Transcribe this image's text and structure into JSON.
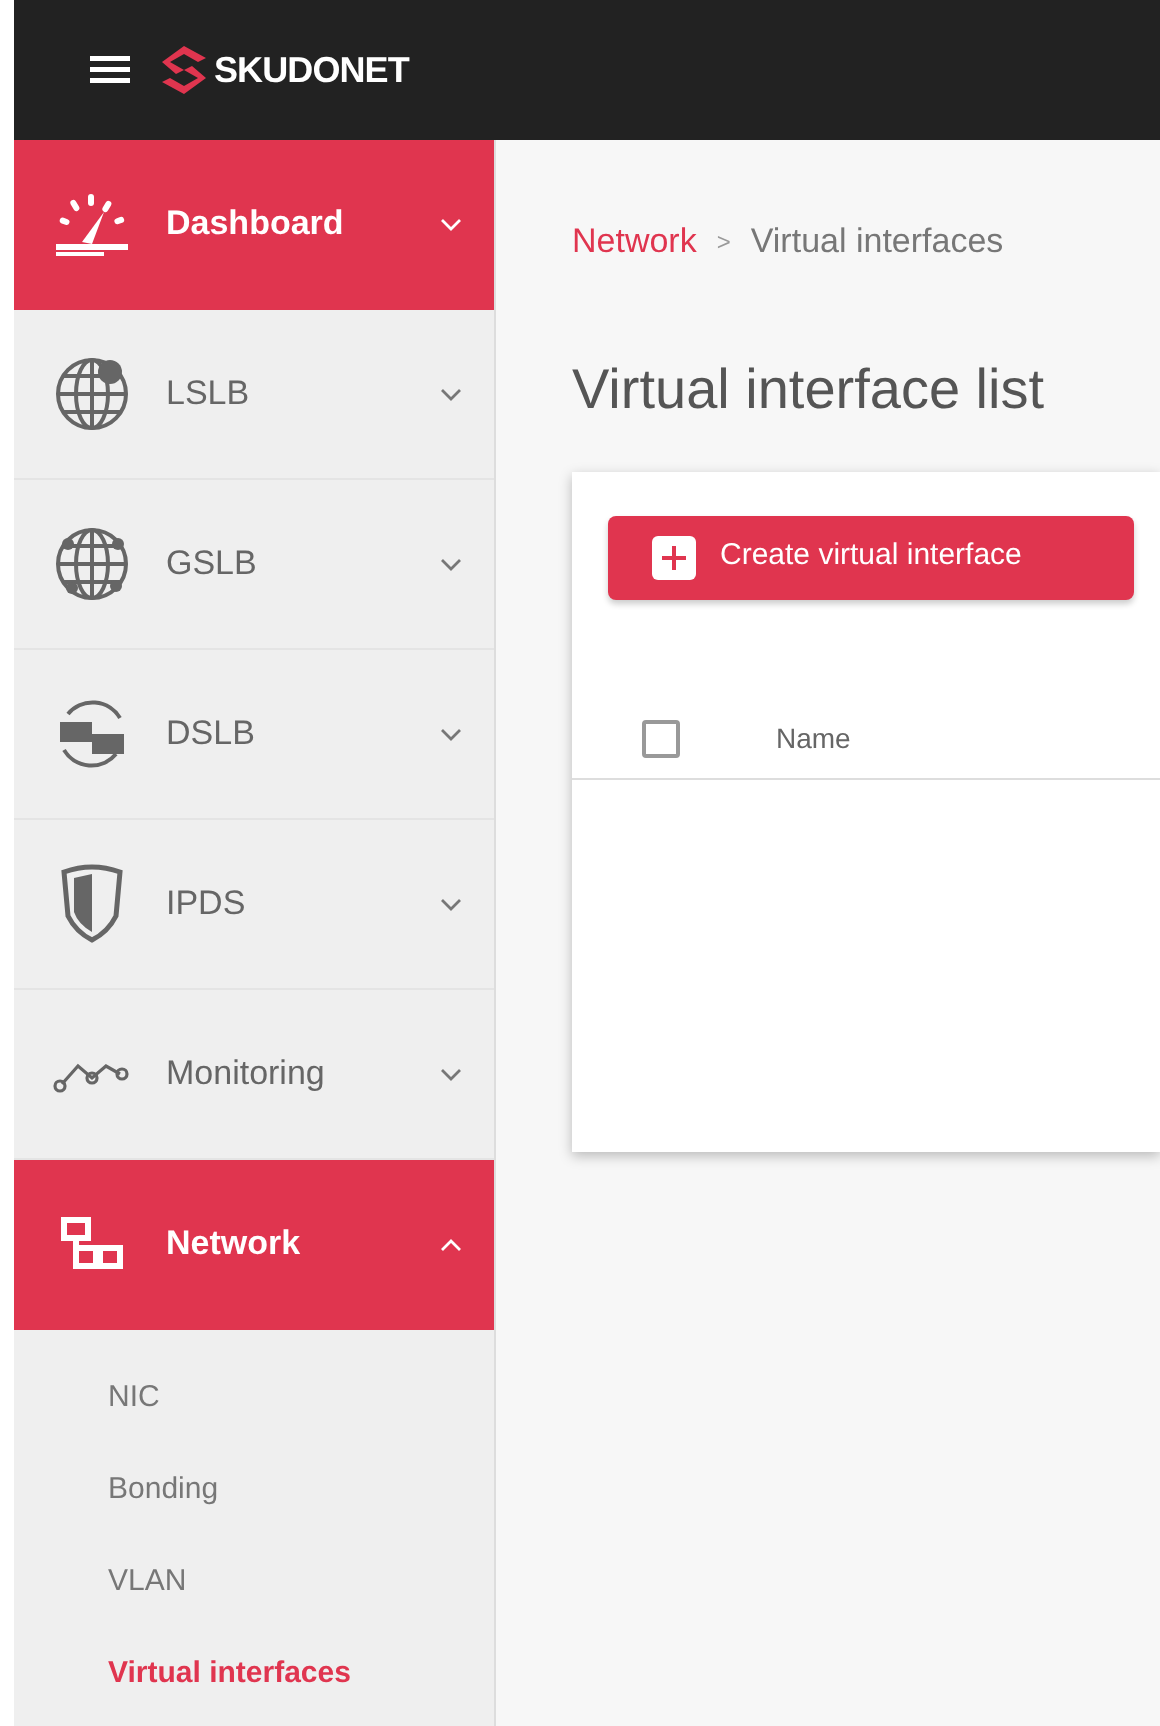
{
  "header": {
    "logo": "SKUDONET"
  },
  "sidebar": {
    "items": [
      {
        "label": "Dashboard",
        "selected": true,
        "expanded": false
      },
      {
        "label": "LSLB",
        "selected": false,
        "expanded": false
      },
      {
        "label": "GSLB",
        "selected": false,
        "expanded": false
      },
      {
        "label": "DSLB",
        "selected": false,
        "expanded": false
      },
      {
        "label": "IPDS",
        "selected": false,
        "expanded": false
      },
      {
        "label": "Monitoring",
        "selected": false,
        "expanded": false
      },
      {
        "label": "Network",
        "selected": true,
        "expanded": true,
        "children": [
          {
            "label": "NIC",
            "selected": false
          },
          {
            "label": "Bonding",
            "selected": false
          },
          {
            "label": "VLAN",
            "selected": false
          },
          {
            "label": "Virtual interfaces",
            "selected": true
          }
        ]
      }
    ]
  },
  "breadcrumb": [
    {
      "label": "Network",
      "link": true
    },
    {
      "label": "Virtual interfaces",
      "link": false
    }
  ],
  "breadcrumb_separator": ">",
  "title": "Virtual interface list",
  "create_button": "Create virtual interface",
  "table": {
    "select_all_checked": false,
    "columns": [
      "Name"
    ]
  }
}
